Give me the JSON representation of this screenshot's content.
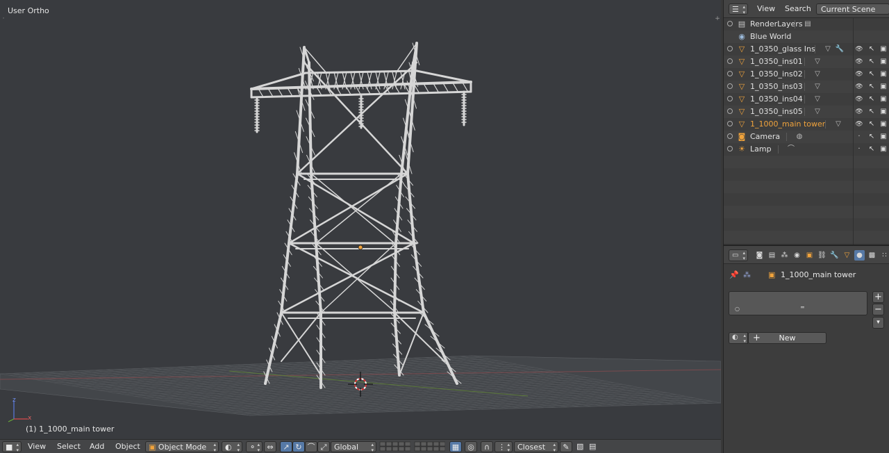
{
  "viewport": {
    "view_label": "User Ortho",
    "active_object_label": "(1) 1_1000_main tower",
    "axis_x": "x",
    "axis_z": "z"
  },
  "bottom_bar": {
    "menu_view": "View",
    "menu_select": "Select",
    "menu_add": "Add",
    "menu_object": "Object",
    "mode": "Object Mode",
    "orientation": "Global",
    "snap_target": "Closest"
  },
  "outliner": {
    "menu_view": "View",
    "menu_search": "Search",
    "display_mode": "Current Scene",
    "rows": [
      {
        "name": "RenderLayers",
        "type": "renderlayers"
      },
      {
        "name": "Blue World",
        "type": "world"
      },
      {
        "name": "1_0350_glass Ins",
        "type": "mesh"
      },
      {
        "name": "1_0350_ins01",
        "type": "mesh"
      },
      {
        "name": "1_0350_ins02",
        "type": "mesh"
      },
      {
        "name": "1_0350_ins03",
        "type": "mesh"
      },
      {
        "name": "1_0350_ins04",
        "type": "mesh"
      },
      {
        "name": "1_0350_ins05",
        "type": "mesh"
      },
      {
        "name": "1_1000_main tower",
        "type": "mesh",
        "active": true
      },
      {
        "name": "Camera",
        "type": "camera"
      },
      {
        "name": "Lamp",
        "type": "lamp"
      }
    ]
  },
  "properties": {
    "object_name": "1_1000_main tower",
    "new_button": "New",
    "add_slot": "+",
    "remove_slot": "−"
  },
  "colors": {
    "viewport_bg": "#393b3f",
    "active_text": "#f0a33c",
    "selected_tab": "#5679a6",
    "mesh_icon": "#f0a33c"
  }
}
